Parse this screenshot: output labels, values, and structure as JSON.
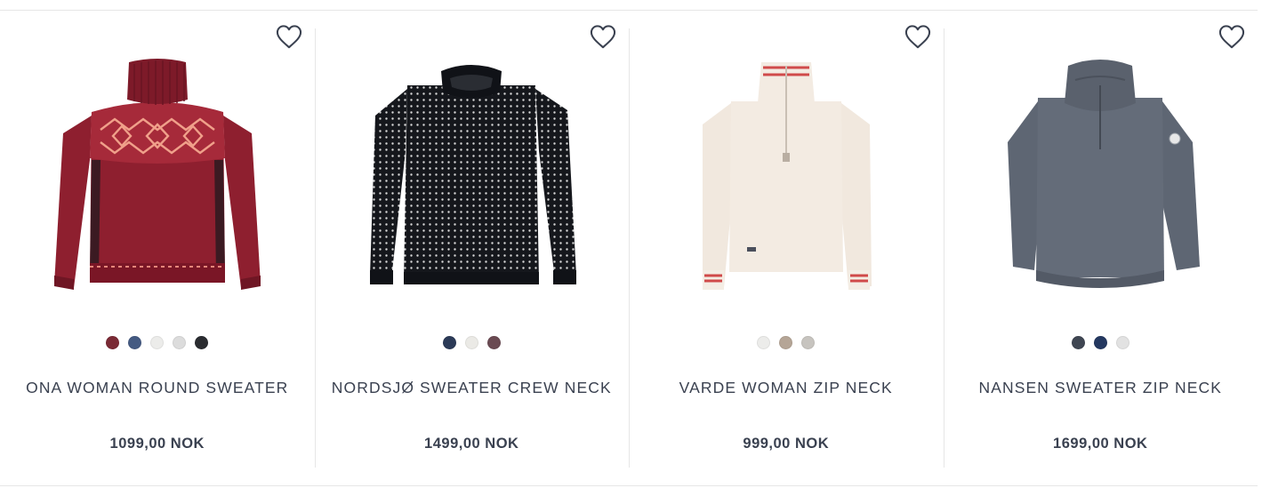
{
  "colors": {
    "text": "#3a4150",
    "divider": "#e6e6e6",
    "heart_stroke": "#3a4150"
  },
  "products": [
    {
      "name": "ONA WOMAN ROUND SWEATER",
      "price": "1099,00 NOK",
      "favorite_icon": "heart-outline-icon",
      "swatches": [
        "#7a2a35",
        "#445a82",
        "#ececea",
        "#dcdcdc",
        "#2a2c30"
      ]
    },
    {
      "name": "NORDSJØ SWEATER CREW NECK",
      "price": "1499,00 NOK",
      "favorite_icon": "heart-outline-icon",
      "swatches": [
        "#2b3a57",
        "#ebeae6",
        "#6a4a52"
      ]
    },
    {
      "name": "VARDE WOMAN ZIP NECK",
      "price": "999,00 NOK",
      "favorite_icon": "heart-outline-icon",
      "swatches": [
        "#ececea",
        "#b5a596",
        "#c7c4bf"
      ]
    },
    {
      "name": "NANSEN SWEATER ZIP NECK",
      "price": "1699,00 NOK",
      "favorite_icon": "heart-outline-icon",
      "swatches": [
        "#3f4652",
        "#243860",
        "#e2e2e2"
      ]
    }
  ]
}
